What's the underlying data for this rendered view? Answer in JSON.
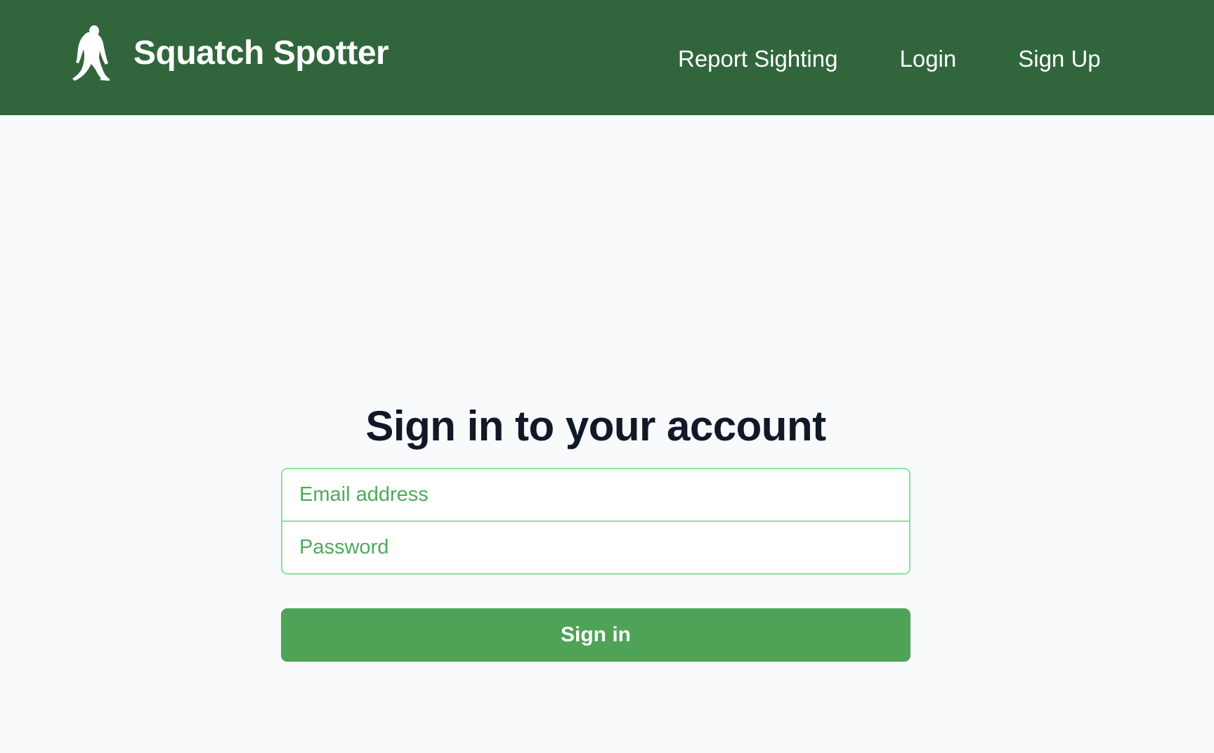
{
  "header": {
    "logo_icon": "bigfoot-silhouette-icon",
    "brand_name": "Squatch Spotter",
    "nav": {
      "report_label": "Report Sighting",
      "login_label": "Login",
      "signup_label": "Sign Up"
    }
  },
  "main": {
    "title": "Sign in to your account",
    "form": {
      "email_placeholder": "Email address",
      "password_placeholder": "Password",
      "submit_label": "Sign in"
    }
  },
  "colors": {
    "header_bg": "#31663c",
    "page_bg": "#f8fafc",
    "accent_green": "#4fa357",
    "field_border": "#86e39a",
    "placeholder_text": "#4eaa5a",
    "title_text": "#111827"
  }
}
